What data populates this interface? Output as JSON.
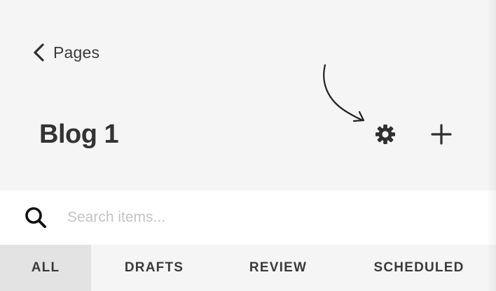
{
  "header": {
    "back_label": "Pages",
    "title": "Blog 1",
    "icons": {
      "back": "chevron-left-icon",
      "settings": "gear-icon",
      "add": "plus-icon",
      "annotation": "arrow-annotation-icon"
    }
  },
  "search": {
    "placeholder": "Search items...",
    "value": "",
    "icon": "search-icon"
  },
  "tabs": [
    {
      "label": "ALL",
      "active": true
    },
    {
      "label": "DRAFTS",
      "active": false
    },
    {
      "label": "REVIEW",
      "active": false
    },
    {
      "label": "SCHEDULED",
      "active": false
    }
  ],
  "colors": {
    "background": "#f5f5f5",
    "search_background": "#ffffff",
    "active_tab": "#e3e3e3",
    "text": "#333333",
    "placeholder": "#c4c4c4"
  }
}
